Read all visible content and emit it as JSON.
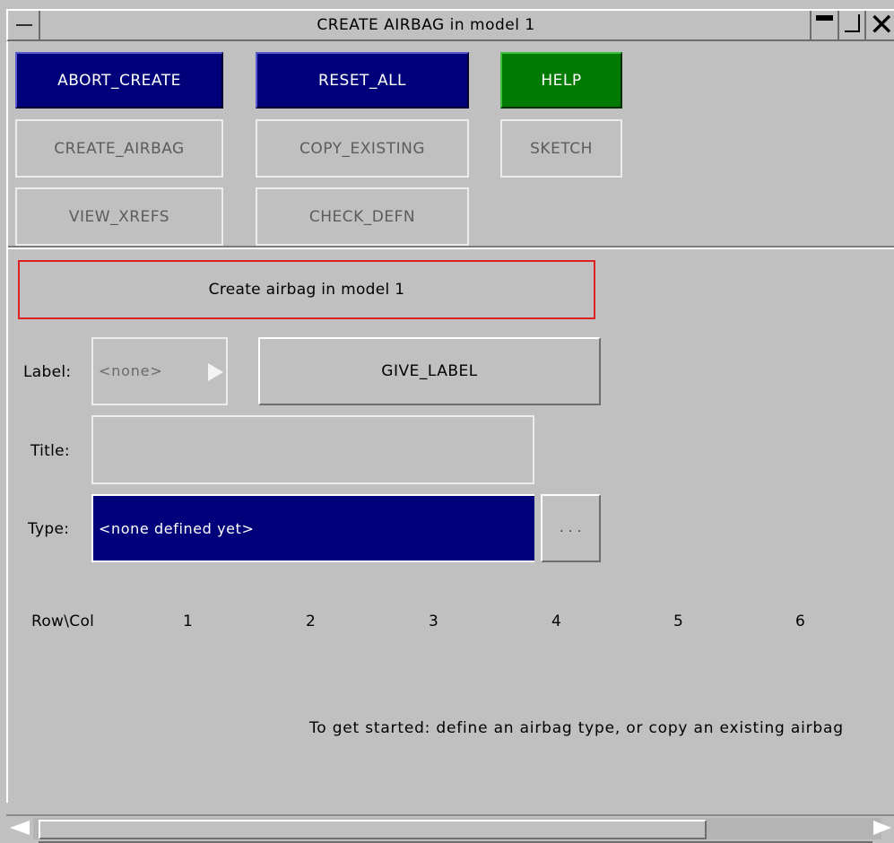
{
  "window": {
    "title": "CREATE AIRBAG in model 1"
  },
  "toolbar": {
    "abort_create": "ABORT_CREATE",
    "reset_all": "RESET_ALL",
    "help": "HELP",
    "create_airbag": "CREATE_AIRBAG",
    "copy_existing": "COPY_EXISTING",
    "sketch": "SKETCH",
    "view_xrefs": "VIEW_XREFS",
    "check_defn": "CHECK_DEFN"
  },
  "form": {
    "header": "Create airbag in model 1",
    "label_caption": "Label:",
    "label_value": "<none>",
    "give_label": "GIVE_LABEL",
    "title_caption": "Title:",
    "title_value": "",
    "type_caption": "Type:",
    "type_value": "<none defined yet>",
    "type_more": ". . ."
  },
  "table": {
    "row_col_header": "Row\\Col",
    "columns": [
      "1",
      "2",
      "3",
      "4",
      "5",
      "6"
    ]
  },
  "hint": "To get started: define an airbag type, or copy an existing airbag",
  "colors": {
    "primary_button": "#00007a",
    "help_button": "#007a00",
    "header_border": "#e02020",
    "background": "#c0c0c0"
  },
  "icons": {
    "window_menu": "window-menu-icon",
    "minimize": "minimize-icon",
    "maximize": "maximize-icon",
    "close": "close-icon",
    "label_dropdown": "dropdown-arrow-icon",
    "scroll_left": "scroll-left-icon",
    "scroll_right": "scroll-right-icon"
  }
}
